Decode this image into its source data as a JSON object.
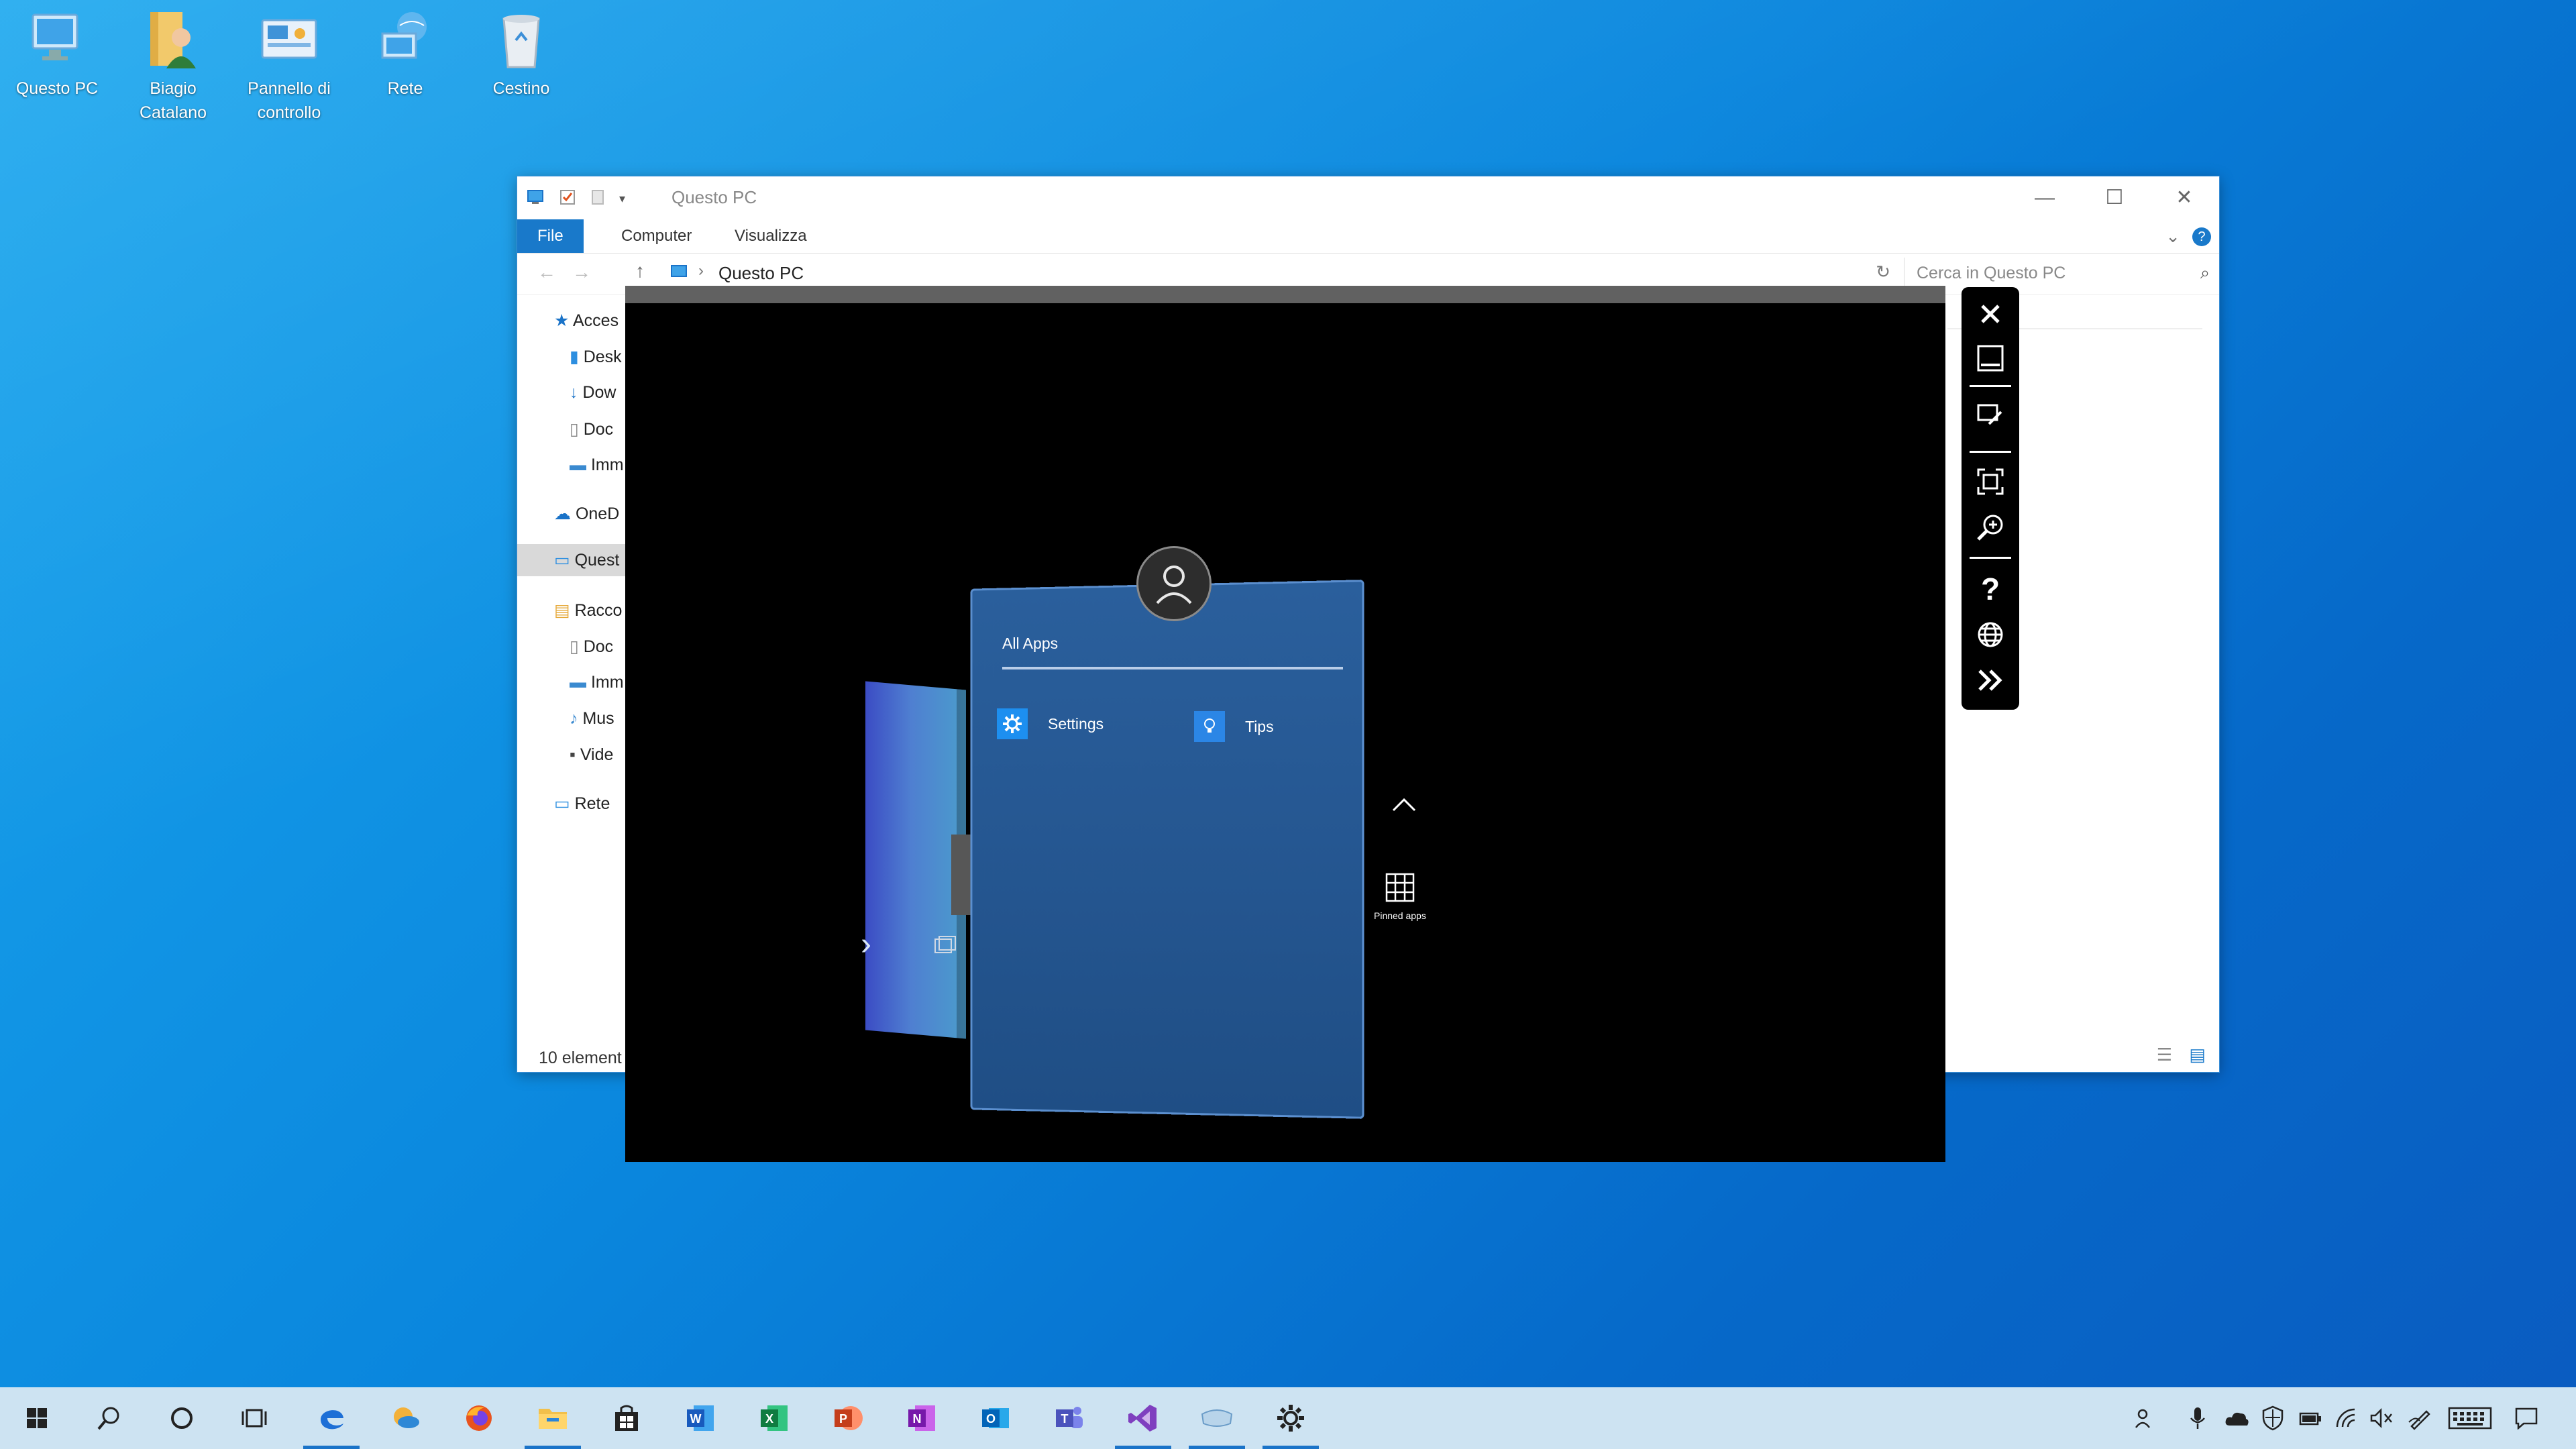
{
  "desktop": {
    "icons": [
      {
        "label": "Questo PC"
      },
      {
        "label": "Biagio Catalano"
      },
      {
        "label": "Pannello di controllo"
      },
      {
        "label": "Rete"
      },
      {
        "label": "Cestino"
      }
    ]
  },
  "explorer": {
    "title": "Questo PC",
    "ribbon_tabs": [
      "File",
      "Computer",
      "Visualizza"
    ],
    "address": "Questo PC",
    "search_placeholder": "Cerca in Questo PC",
    "nav": [
      "Acces",
      "Desk",
      "Dow",
      "Doc",
      "Imm",
      "OneD",
      "Quest",
      "Racco",
      "Doc",
      "Imm",
      "Mus",
      "Vide",
      "Rete"
    ],
    "status": "10 element"
  },
  "viewer": {
    "all_apps": "All Apps",
    "apps": [
      {
        "label": "Settings",
        "icon": "gear-icon"
      },
      {
        "label": "Tips",
        "icon": "lightbulb-icon"
      }
    ],
    "pinned_label": "Pinned apps"
  },
  "toolbar": {
    "buttons": [
      "close-icon",
      "minimize-icon",
      "edit-icon",
      "fit-screen-icon",
      "zoom-icon",
      "help-icon",
      "globe-icon",
      "expand-icon"
    ]
  },
  "taskbar": {
    "apps": [
      "start",
      "search",
      "cortana",
      "task-view",
      "edge",
      "outlook-calendar",
      "firefox",
      "file-explorer",
      "store",
      "word",
      "excel",
      "powerpoint",
      "onenote",
      "outlook",
      "teams",
      "visual-studio",
      "mixed-reality",
      "settings"
    ]
  },
  "colors": {
    "accent": "#1979ca",
    "panel": "#24558f",
    "taskbar": "#cde3f2"
  }
}
